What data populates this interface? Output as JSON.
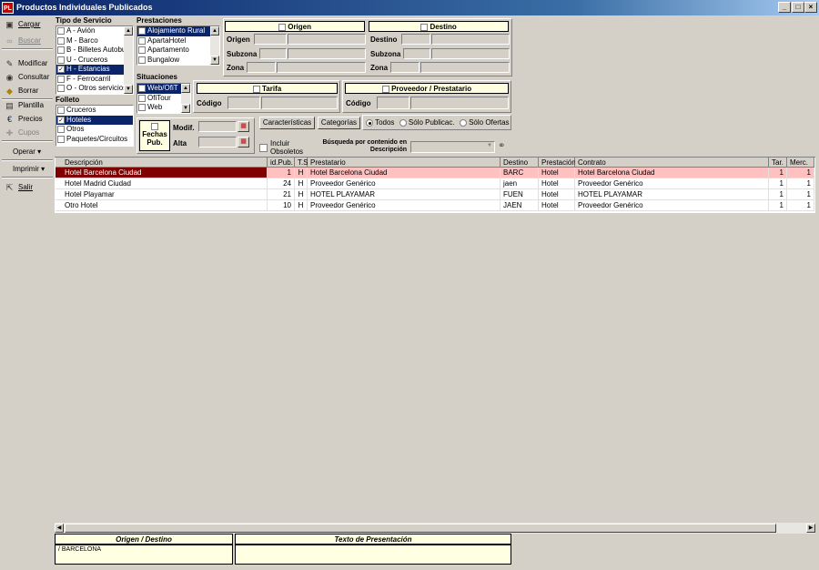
{
  "window": {
    "title": "Productos Individuales Publicados",
    "icon_label": "PL",
    "minimize": "_",
    "maximize": "□",
    "close": "×"
  },
  "sidebar": {
    "items": [
      {
        "label": "Cargar",
        "icon": "load-icon",
        "enabled": true
      },
      {
        "label": "Buscar",
        "icon": "binoculars-icon",
        "enabled": false
      },
      {
        "label": "Modificar",
        "icon": "edit-icon",
        "enabled": true
      },
      {
        "label": "Consultar",
        "icon": "query-icon",
        "enabled": true
      },
      {
        "label": "Borrar",
        "icon": "eraser-icon",
        "enabled": true
      },
      {
        "label": "Plantilla",
        "icon": "template-icon",
        "enabled": true
      },
      {
        "label": "Precios",
        "icon": "euro-icon",
        "enabled": true
      },
      {
        "label": "Cupos",
        "icon": "quota-icon",
        "enabled": false
      },
      {
        "label": "Operar",
        "icon": "dropdown-icon",
        "enabled": true
      },
      {
        "label": "Imprimir",
        "icon": "dropdown-icon",
        "enabled": true
      },
      {
        "label": "Salir",
        "icon": "exit-icon",
        "enabled": true
      }
    ]
  },
  "tipo_servicio": {
    "label": "Tipo de Servicio",
    "items": [
      {
        "label": "A - Avión",
        "checked": false,
        "selected": false
      },
      {
        "label": "M - Barco",
        "checked": false,
        "selected": false
      },
      {
        "label": "B - Billetes Autobu",
        "checked": false,
        "selected": false
      },
      {
        "label": "U - Cruceros",
        "checked": false,
        "selected": false
      },
      {
        "label": "H - Estancias",
        "checked": true,
        "selected": true
      },
      {
        "label": "F - Ferrocarril",
        "checked": false,
        "selected": false
      },
      {
        "label": "O - Otros servicios",
        "checked": false,
        "selected": false
      }
    ]
  },
  "folleto": {
    "label": "Folleto",
    "items": [
      {
        "label": "Cruceros",
        "checked": false,
        "selected": false
      },
      {
        "label": "Hoteles",
        "checked": true,
        "selected": true
      },
      {
        "label": "Otros",
        "checked": false,
        "selected": false
      },
      {
        "label": "Paquetes/Circuitos",
        "checked": false,
        "selected": false
      }
    ]
  },
  "prestaciones": {
    "label": "Prestaciones",
    "items": [
      {
        "label": "Alojamiento Rural",
        "checked": false,
        "selected": true
      },
      {
        "label": "ApartaHotel",
        "checked": false,
        "selected": false
      },
      {
        "label": "Apartamento",
        "checked": false,
        "selected": false
      },
      {
        "label": "Bungalow",
        "checked": false,
        "selected": false
      }
    ]
  },
  "situaciones": {
    "label": "Situaciones",
    "items": [
      {
        "label": "Web/OfiT",
        "checked": false,
        "selected": true
      },
      {
        "label": "OfiTour",
        "checked": false,
        "selected": false
      },
      {
        "label": "Web",
        "checked": false,
        "selected": false
      }
    ]
  },
  "fechas": {
    "pub_label_1": "Fechas",
    "pub_label_2": "Pub.",
    "modif_label": "Modif.",
    "alta_label": "Alta"
  },
  "origen": {
    "title": "Origen",
    "origen_label": "Origen",
    "subzona_label": "Subzona",
    "zona_label": "Zona"
  },
  "destino": {
    "title": "Destino",
    "destino_label": "Destino",
    "subzona_label": "Subzona",
    "zona_label": "Zona"
  },
  "tarifa": {
    "title": "Tarifa",
    "codigo_label": "Código"
  },
  "proveedor": {
    "title": "Proveedor / Prestatario",
    "codigo_label": "Código"
  },
  "filters": {
    "caracteristicas": "Características",
    "categorias": "Categorías",
    "radios": [
      {
        "label": "Todos",
        "on": true
      },
      {
        "label": "Sólo Publicac.",
        "on": false
      },
      {
        "label": "Sólo Ofertas",
        "on": false
      }
    ],
    "incluir_1": "Incluir",
    "incluir_2": "Obsoletos",
    "busqueda_1": "Búsqueda por contenido en",
    "busqueda_2": "Descripción"
  },
  "table": {
    "headers": [
      "Descripción",
      "id.Pub.",
      "T.S.",
      "Prestatario",
      "Destino",
      "Prestación",
      "Contrato",
      "Tar.",
      "Merc."
    ],
    "rows": [
      [
        "Hotel Barcelona Ciudad",
        "1",
        "H",
        "Hotel Barcelona Ciudad",
        "BARC",
        "Hotel",
        "Hotel Barcelona Ciudad",
        "1",
        "1"
      ],
      [
        "Hotel Madrid Ciudad",
        "24",
        "H",
        "Proveedor Genérico",
        "jaen",
        "Hotel",
        "Proveedor Genérico",
        "1",
        "1"
      ],
      [
        "Hotel Playamar",
        "21",
        "H",
        "HOTEL PLAYAMAR",
        "FUEN",
        "Hotel",
        "HOTEL PLAYAMAR",
        "1",
        "1"
      ],
      [
        "Otro Hotel",
        "10",
        "H",
        "Proveedor Genérico",
        "JAEN",
        "Hotel",
        "Proveedor Genérico",
        "1",
        "1"
      ]
    ]
  },
  "bottom": {
    "origen_destino_title": "Origen / Destino",
    "origen_destino_value": "/ BARCELONA",
    "texto_title": "Texto de Presentación",
    "texto_value": ""
  },
  "colors": {
    "selected_row_bg": "#800000",
    "highlight_row_bg": "#ffc0c0",
    "yellow_panel": "#ffffe1"
  }
}
